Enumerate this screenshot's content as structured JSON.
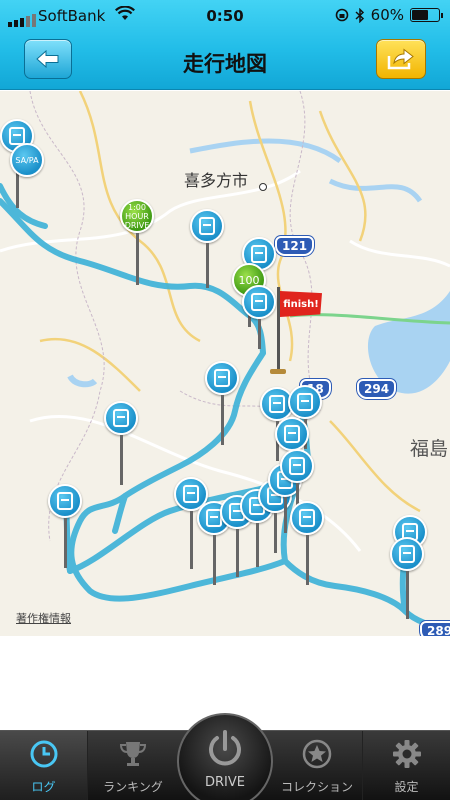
{
  "status_bar": {
    "carrier": "SoftBank",
    "time": "0:50",
    "battery": "60%",
    "battery_level": 0.6
  },
  "header": {
    "title": "走行地図",
    "back_icon": "arrow-left-icon",
    "share_icon": "share-arrow-icon"
  },
  "map": {
    "city_label": "喜多方市",
    "prefecture_label": "福島",
    "copyright_link": "著作権情報",
    "route_shields": [
      "121",
      "294",
      "289",
      "18"
    ],
    "finish_label": "finish!",
    "milestone_badges": [
      "1:00 HOUR DRIVE",
      "100"
    ],
    "route_color": "#3fb3d8"
  },
  "tabs": {
    "log": "ログ",
    "ranking": "ランキング",
    "drive": "DRIVE",
    "collection": "コレクション",
    "settings": "設定",
    "active_color": "#49c7f4"
  }
}
